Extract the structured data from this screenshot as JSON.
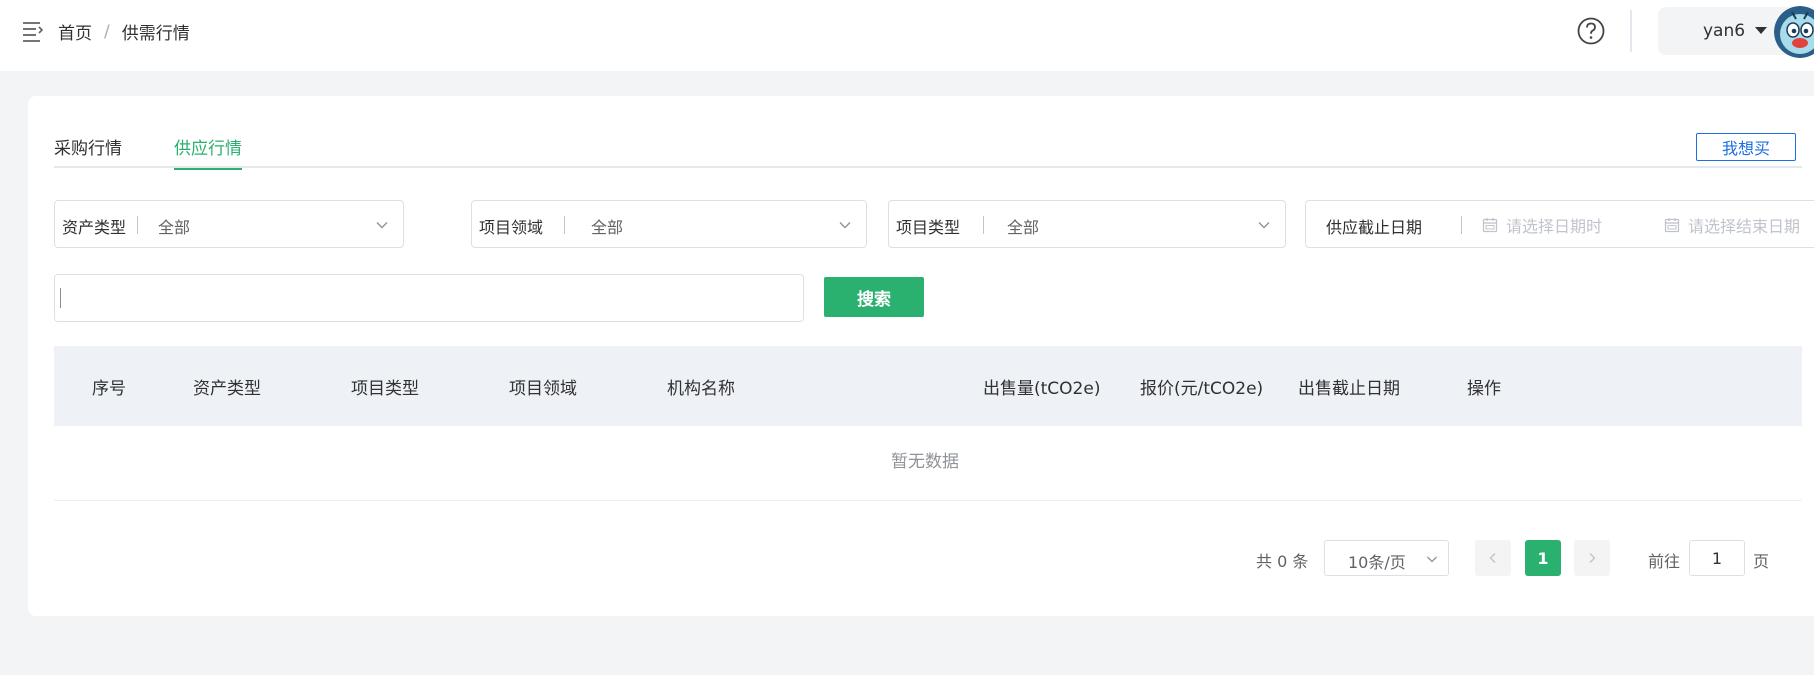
{
  "header": {
    "breadcrumb_home": "首页",
    "breadcrumb_sep": "/",
    "breadcrumb_current": "供需行情",
    "username": "yan6"
  },
  "tabs": [
    {
      "label": "采购行情",
      "active": false
    },
    {
      "label": "供应行情",
      "active": true
    }
  ],
  "want_buy_label": "我想买",
  "filters": {
    "asset_type": {
      "label": "资产类型",
      "value": "全部"
    },
    "project_field": {
      "label": "项目领域",
      "value": "全部"
    },
    "project_type": {
      "label": "项目类型",
      "value": "全部"
    },
    "deadline": {
      "label": "供应截止日期",
      "start_placeholder": "请选择日期时",
      "end_placeholder": "请选择结束日期"
    }
  },
  "search": {
    "value": "",
    "button_label": "搜索"
  },
  "table": {
    "columns": [
      "序号",
      "资产类型",
      "项目类型",
      "项目领域",
      "机构名称",
      "出售量(tCO2e)",
      "报价(元/tCO2e)",
      "出售截止日期",
      "操作"
    ],
    "empty_text": "暂无数据"
  },
  "pagination": {
    "total_text": "共 0 条",
    "page_size": "10条/页",
    "current_page": "1",
    "goto_label": "前往",
    "goto_value": "1",
    "goto_suffix": "页"
  },
  "colors": {
    "accent": "#2ab06f",
    "link": "#1d6fe0",
    "background": "#f3f4f5",
    "table_header": "#eef1f5"
  },
  "icons": [
    "menu-fold-icon",
    "help-circle-icon",
    "caret-down-icon",
    "avatar",
    "chevron-down-icon",
    "calendar-icon",
    "chevron-left-icon",
    "chevron-right-icon"
  ]
}
